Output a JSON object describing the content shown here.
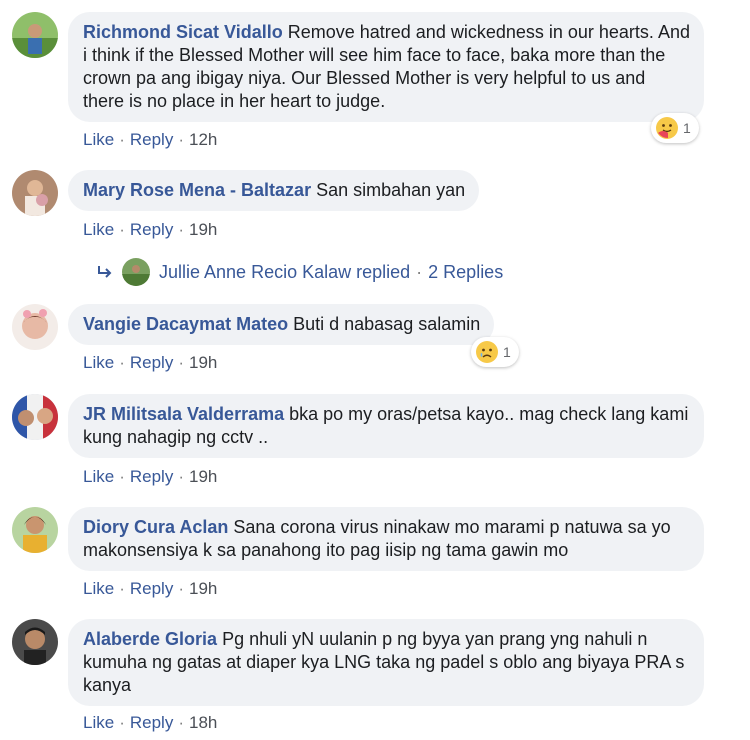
{
  "comments": [
    {
      "author": "Richmond Sicat Vidallo",
      "text": "Remove hatred and wickedness in our hearts. And i think if the Blessed Mother will see him face to face, baka more than the crown pa ang ibigay niya. Our Blessed Mother is very helpful to us and there is no place in her heart to judge.",
      "like": "Like",
      "reply": "Reply",
      "time": "12h",
      "reaction": {
        "icon": "hug-reaction-icon",
        "count": "1"
      }
    },
    {
      "author": "Mary Rose Mena - Baltazar",
      "text": "San simbahan yan",
      "like": "Like",
      "reply": "Reply",
      "time": "19h"
    },
    {
      "author": "Vangie Dacaymat Mateo",
      "text": "Buti d nabasag salamin",
      "like": "Like",
      "reply": "Reply",
      "time": "19h",
      "reaction": {
        "icon": "sad-reaction-icon",
        "count": "1"
      }
    },
    {
      "author": "JR Militsala Valderrama",
      "text": "bka po my oras/petsa kayo.. mag check lang kami kung nahagip ng cctv ..",
      "like": "Like",
      "reply": "Reply",
      "time": "19h"
    },
    {
      "author": "Diory Cura Aclan",
      "text": "Sana corona virus ninakaw mo marami p natuwa sa yo makonsensiya k sa panahong ito pag iisip ng tama gawin mo",
      "like": "Like",
      "reply": "Reply",
      "time": "19h"
    },
    {
      "author": "Alaberde Gloria",
      "text": "Pg nhuli yN uulanin p ng byya yan prang yng nahuli n kumuha ng gatas at diaper kya LNG taka ng padel s oblo ang biyaya PRA s kanya",
      "like": "Like",
      "reply": "Reply",
      "time": "18h"
    }
  ],
  "replies_link": {
    "replier": "Jullie Anne Recio Kalaw replied",
    "count_label": "2 Replies"
  },
  "separator": "·",
  "colors": {
    "link": "#385898",
    "bubble": "#f0f2f5",
    "meta": "#4b4f56"
  }
}
